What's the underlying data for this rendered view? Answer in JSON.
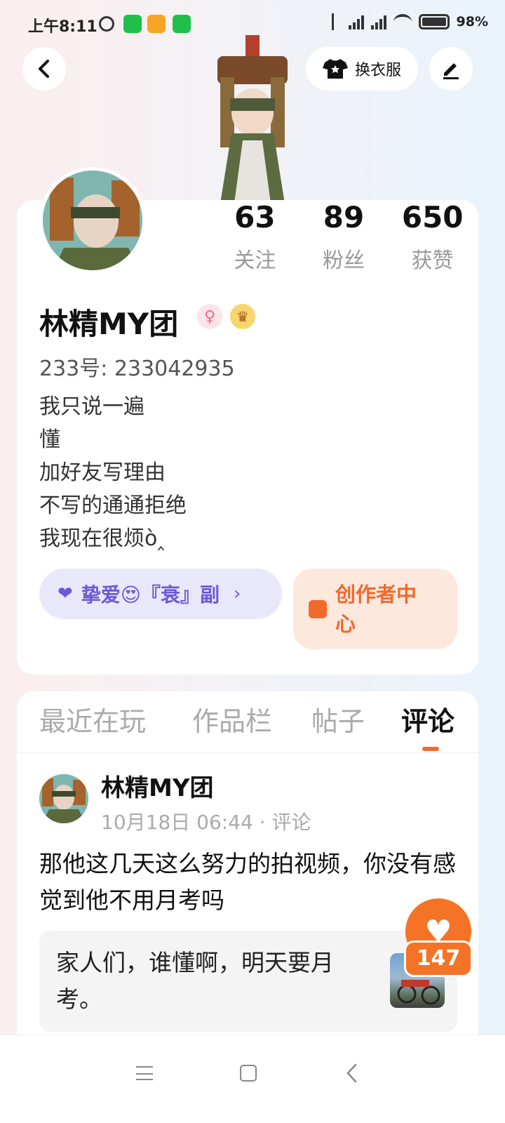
{
  "status_bar": {
    "time": "上午8:11",
    "battery": "98%",
    "icons": [
      "alarm-icon",
      "wechat-icon",
      "note-app-icon",
      "shield-app-icon",
      "bluetooth-icon",
      "signal-icon",
      "hd-signal-icon",
      "wifi-icon",
      "battery-icon"
    ]
  },
  "header": {
    "back_icon": "chevron-left-icon",
    "outfit_label": "换衣服",
    "outfit_icon": "tshirt-icon",
    "edit_icon": "pencil-icon"
  },
  "profile": {
    "stats": [
      {
        "value": "63",
        "label": "关注"
      },
      {
        "value": "89",
        "label": "粉丝"
      },
      {
        "value": "650",
        "label": "获赞"
      }
    ],
    "username": "林精MY团",
    "gender_badge": "♀",
    "crown_badge": "♛",
    "user_id": "233号: 233042935",
    "bio_lines": [
      "我只说一遍",
      "懂",
      "加好友写理由",
      "不写的通通拒绝",
      "我现在很烦ò‸"
    ],
    "bestie_label": "挚爱😍『衰』副",
    "bestie_chevron": "›",
    "creator_label": "创作者中心"
  },
  "tabs": {
    "items": [
      "最近在玩",
      "作品栏",
      "帖子",
      "评论"
    ],
    "active": "评论"
  },
  "comment": {
    "author": "林精MY团",
    "meta": "10月18日 06:44 · 评论",
    "body": "那他这几天这么努力的拍视频，你没有感觉到他不用月考吗",
    "quote": "家人们，谁懂啊，明天要月考。",
    "likes": "147"
  },
  "colors": {
    "accent": "#f47326",
    "bestie": "#6a5ad8",
    "creator_bg": "#fde8de"
  }
}
